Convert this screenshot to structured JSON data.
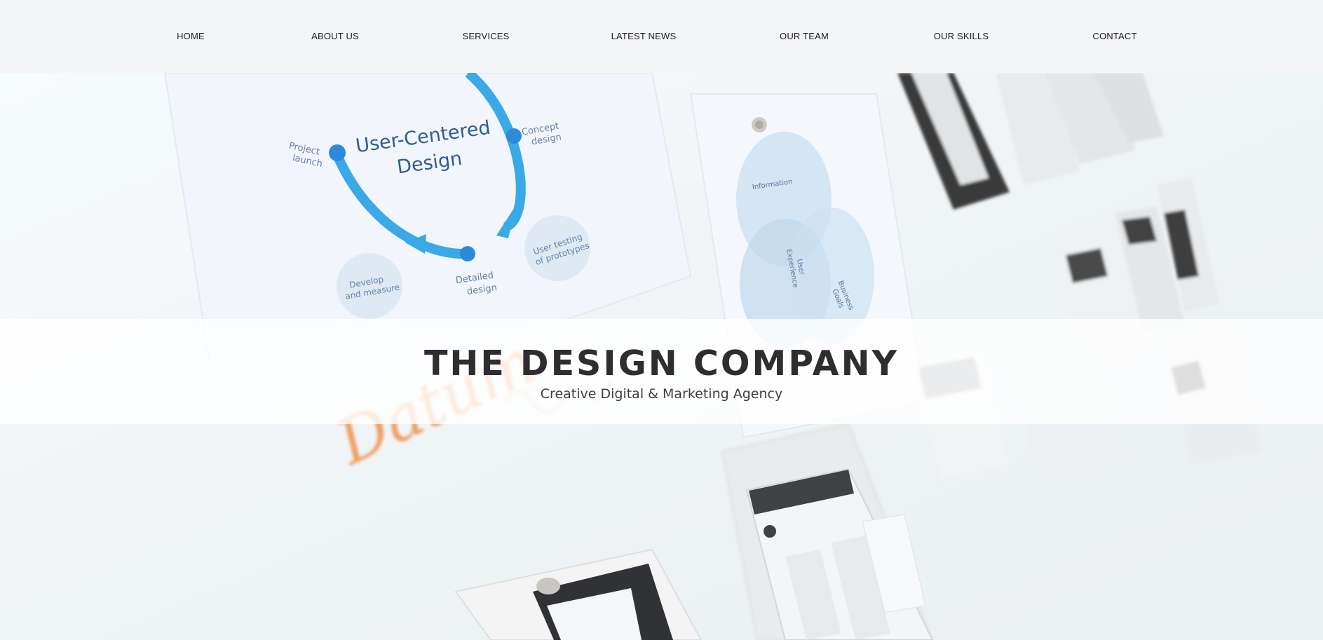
{
  "nav": {
    "items": [
      {
        "label": "HOME"
      },
      {
        "label": "ABOUT US"
      },
      {
        "label": "SERVICES"
      },
      {
        "label": "LATEST NEWS"
      },
      {
        "label": "OUR TEAM"
      },
      {
        "label": "OUR SKILLS"
      },
      {
        "label": "CONTACT"
      }
    ]
  },
  "hero": {
    "title": "THE DESIGN COMPANY",
    "tagline": "Creative Digital & Marketing Agency",
    "image_text": {
      "ucd_title_line1": "User-Centered",
      "ucd_title_line2": "Design",
      "project_launch_line1": "Project",
      "project_launch_line2": "launch",
      "concept_line1": "Concept",
      "concept_line2": "design",
      "testing_line1": "User testing",
      "testing_line2": "of prototypes",
      "detailed_line1": "Detailed",
      "detailed_line2": "design",
      "develop_line1": "Develop",
      "develop_line2": "and measure",
      "venn_information": "Information",
      "venn_user_line1": "User",
      "venn_user_line2": "Experience",
      "venn_business_line1": "Business",
      "venn_business_line2": "Goals",
      "handwriting": "Datum"
    }
  },
  "colors": {
    "nav_background": "#f4f5f6",
    "title_text": "#2f2d30",
    "accent_blue": "#29a3e3",
    "handwriting_orange": "#f08a3c"
  }
}
